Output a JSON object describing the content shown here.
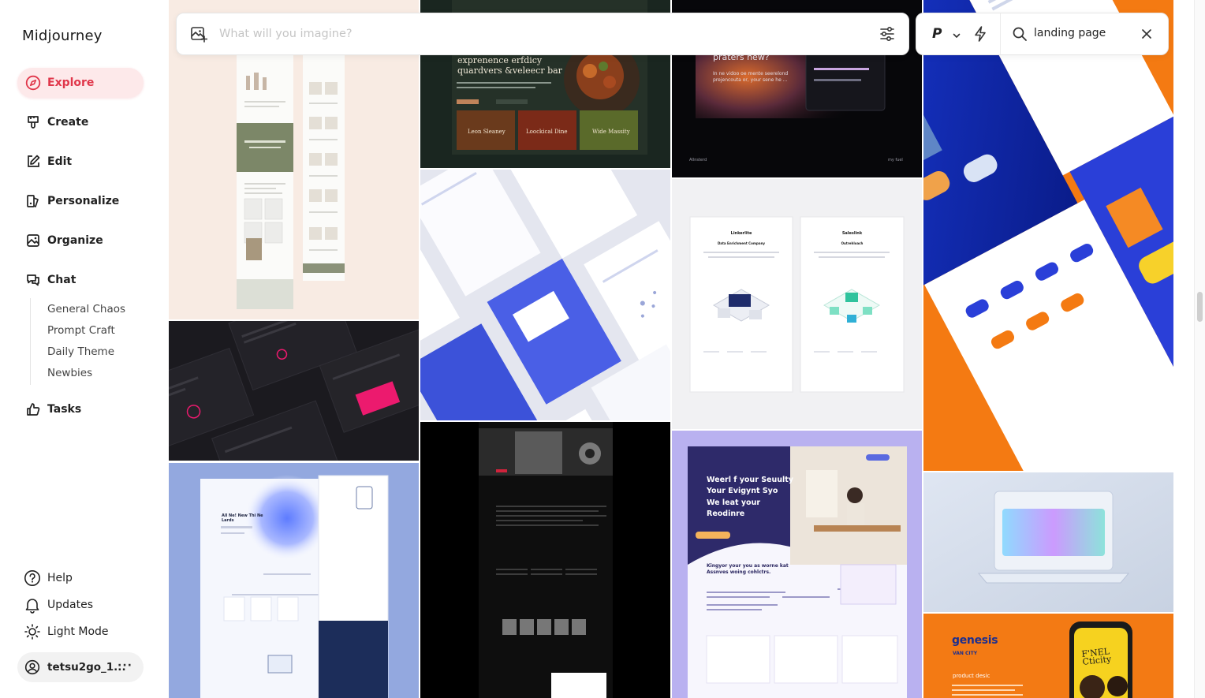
{
  "app": {
    "title": "Midjourney"
  },
  "nav": [
    {
      "label": "Explore",
      "icon": "compass-icon",
      "active": true
    },
    {
      "label": "Create",
      "icon": "brush-icon"
    },
    {
      "label": "Edit",
      "icon": "edit-icon"
    },
    {
      "label": "Personalize",
      "icon": "personalize-icon"
    },
    {
      "label": "Organize",
      "icon": "image-folder-icon"
    },
    {
      "label": "Chat",
      "icon": "chat-icon"
    }
  ],
  "chat_rooms": [
    "General Chaos",
    "Prompt Craft",
    "Daily Theme",
    "Newbies"
  ],
  "tasks": {
    "label": "Tasks",
    "icon": "thumbs-up-icon"
  },
  "footer": {
    "help": "Help",
    "updates": "Updates",
    "light_mode": "Light Mode"
  },
  "user": {
    "name": "tetsu2go_1...",
    "more": "···"
  },
  "prompt": {
    "placeholder": "What will you imagine?",
    "value": ""
  },
  "search": {
    "mode_label": "P",
    "value": "landing page"
  },
  "gallery": {
    "tiles": [
      {
        "name": "tile-skincare-longform"
      },
      {
        "name": "tile-restaurant-dark",
        "headline": "exprenence erfdicy quardvers &veleecr bar",
        "labels": [
          "Leon Sleaney",
          "Loockical Dine",
          "Wide Massity"
        ]
      },
      {
        "name": "tile-dark-gradient-app",
        "headline": "praters new?",
        "sub": "In ne vidoo oe mente seerelond prejencouta or, your sene he ...",
        "footer_left": "Allnsterd",
        "footer_right": "my fuel"
      },
      {
        "name": "tile-sneaker-orange-blue"
      },
      {
        "name": "tile-isometric-blue"
      },
      {
        "name": "tile-data-companies",
        "left_title": "Linkerlite",
        "left_sub": "Data Enrichment Company",
        "right_title": "Saleslink",
        "right_sub": "Outrehloach"
      },
      {
        "name": "tile-black-pink-mockups"
      },
      {
        "name": "tile-glassmorphism-laptop"
      },
      {
        "name": "tile-blue-gradient-pages",
        "headline": "All Ne! New Thi Ne Lards"
      },
      {
        "name": "tile-monochrome-music"
      },
      {
        "name": "tile-purple-workspace",
        "headline": "Weerl f your Seuulty Your Evigynt Syo We leat your Reodinre",
        "sub": "Kingyor your you as worne kat Assnves woing cohlctrs."
      },
      {
        "name": "tile-genesis-orange",
        "brand": "genesis",
        "brand_sub": "VAN CITY",
        "sub": "product desic",
        "phone_text": "F'NEL Cticity"
      }
    ]
  }
}
